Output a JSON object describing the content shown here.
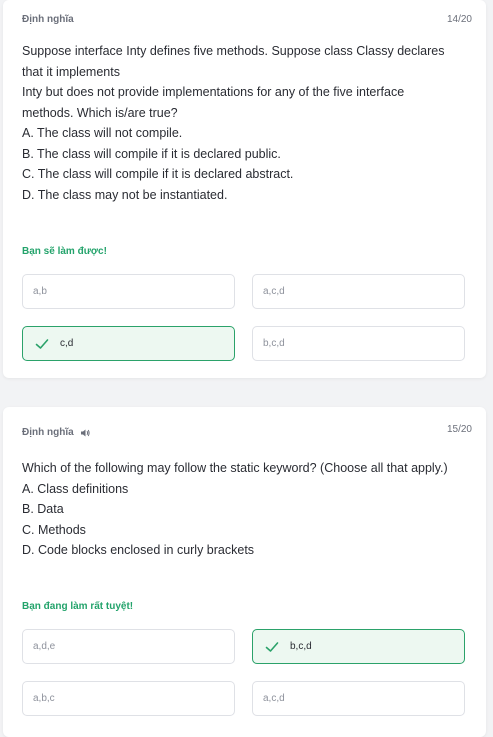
{
  "colors": {
    "accent_green": "#23a36b",
    "correct_bg": "#edf8f1",
    "border": "#dfe1e6"
  },
  "cards": [
    {
      "term_label": "Định nghĩa",
      "counter": "14/20",
      "question_lines": [
        "Suppose interface Inty defines five methods. Suppose class Classy declares",
        "that it implements",
        "Inty but does not provide implementations for any of the five interface",
        "methods. Which is/are true?",
        "A. The class will not compile.",
        "B. The class will compile if it is declared public.",
        "C. The class will compile if it is declared abstract.",
        "D. The class may not be instantiated."
      ],
      "feedback": "Bạn sẽ làm được!",
      "options": [
        {
          "label": "a,b",
          "state": "default"
        },
        {
          "label": "a,c,d",
          "state": "default"
        },
        {
          "label": "c,d",
          "state": "correct",
          "icon": "check-icon"
        },
        {
          "label": "b,c,d",
          "state": "default"
        }
      ]
    },
    {
      "term_label": "Định nghĩa",
      "speaker_icon": "speaker-icon",
      "counter": "15/20",
      "question_lines": [
        "Which of the following may follow the static keyword? (Choose all that apply.)",
        "A. Class definitions",
        "B. Data",
        "C. Methods",
        "D. Code blocks enclosed in curly brackets"
      ],
      "feedback": "Bạn đang làm rất tuyệt!",
      "options": [
        {
          "label": "a,d,e",
          "state": "default"
        },
        {
          "label": "b,c,d",
          "state": "correct",
          "icon": "check-icon"
        },
        {
          "label": "a,b,c",
          "state": "default"
        },
        {
          "label": "a,c,d",
          "state": "default"
        }
      ]
    }
  ]
}
